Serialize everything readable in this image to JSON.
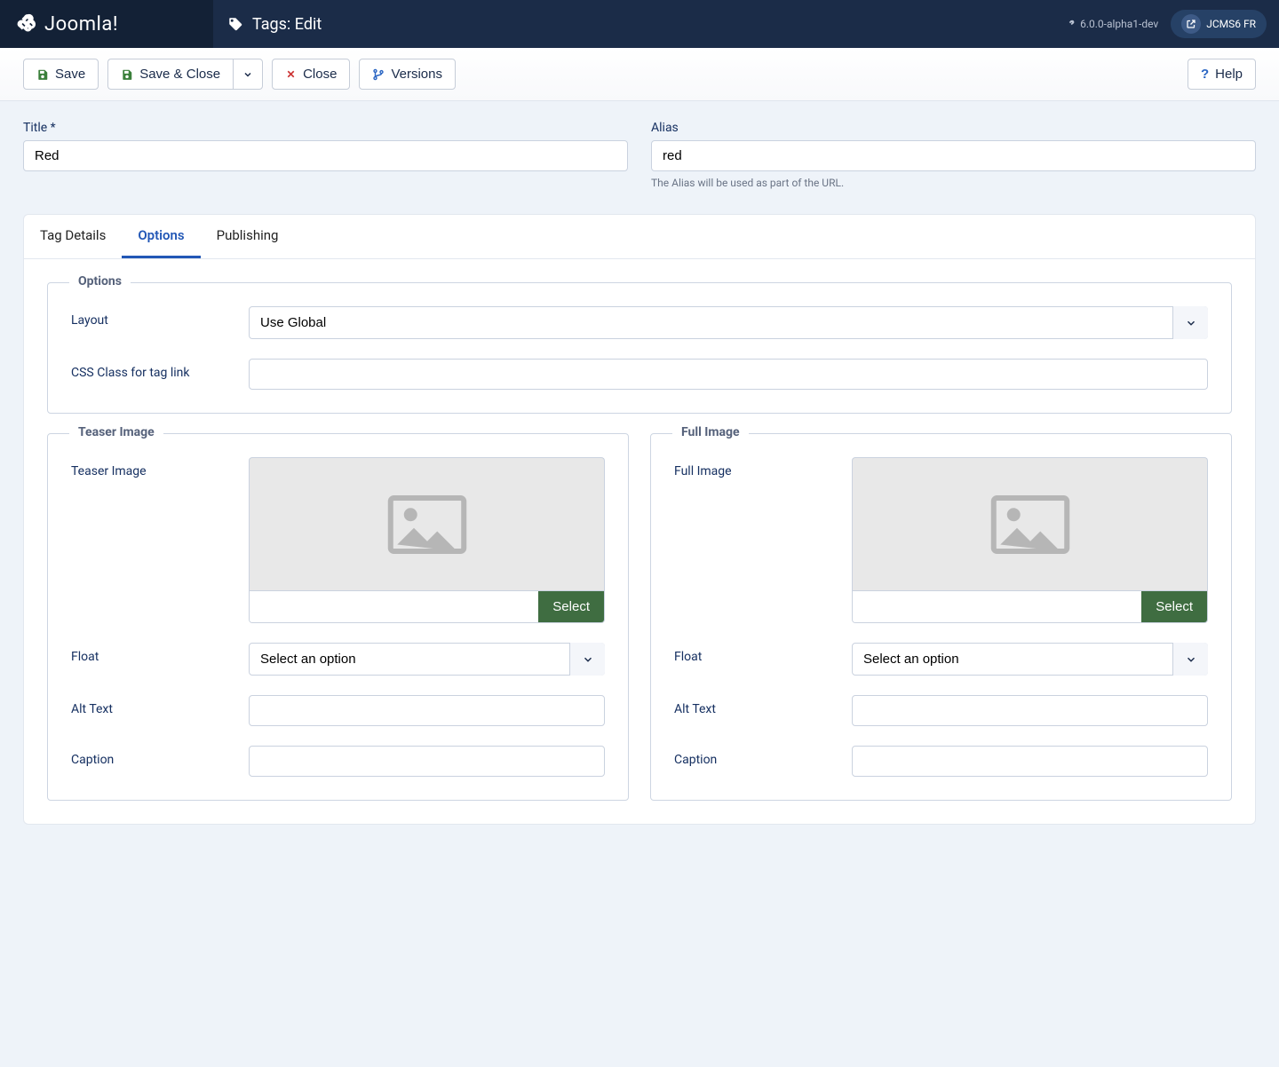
{
  "header": {
    "brand": "Joomla!",
    "page_title": "Tags: Edit",
    "version": "6.0.0-alpha1-dev",
    "site_name": "JCMS6 FR"
  },
  "toolbar": {
    "save": "Save",
    "save_close": "Save & Close",
    "close": "Close",
    "versions": "Versions",
    "help": "Help"
  },
  "fields": {
    "title_label": "Title *",
    "title_value": "Red",
    "alias_label": "Alias",
    "alias_value": "red",
    "alias_hint": "The Alias will be used as part of the URL."
  },
  "tabs": {
    "details": "Tag Details",
    "options": "Options",
    "publishing": "Publishing"
  },
  "options": {
    "legend": "Options",
    "layout_label": "Layout",
    "layout_value": "Use Global",
    "css_label": "CSS Class for tag link",
    "css_value": ""
  },
  "teaser": {
    "legend": "Teaser Image",
    "image_label": "Teaser Image",
    "select": "Select",
    "float_label": "Float",
    "float_value": "Select an option",
    "alt_label": "Alt Text",
    "caption_label": "Caption"
  },
  "full": {
    "legend": "Full Image",
    "image_label": "Full Image",
    "select": "Select",
    "float_label": "Float",
    "float_value": "Select an option",
    "alt_label": "Alt Text",
    "caption_label": "Caption"
  }
}
